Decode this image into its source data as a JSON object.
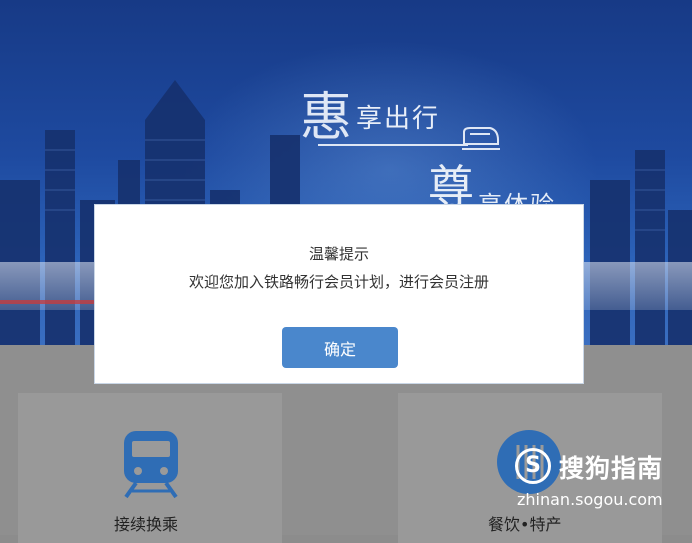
{
  "banner": {
    "slogan1_big": "惠",
    "slogan1_small": "享出行",
    "slogan2_big": "尊",
    "slogan2_small": "享体验"
  },
  "menu": {
    "items": [
      {
        "label": "接续换乘",
        "icon": "train-icon"
      },
      {
        "label": "餐饮•特产",
        "icon": "dining-icon"
      }
    ]
  },
  "dialog": {
    "title": "温馨提示",
    "message": "欢迎您加入铁路畅行会员计划，进行会员注册",
    "confirm_label": "确定"
  },
  "watermark": {
    "logo_letter": "S",
    "brand": "搜狗指南",
    "url": "zhinan.sogou.com"
  },
  "colors": {
    "banner_blue": "#1e4aa0",
    "button_blue": "#4a87cc",
    "icon_blue": "#2f6db5"
  }
}
